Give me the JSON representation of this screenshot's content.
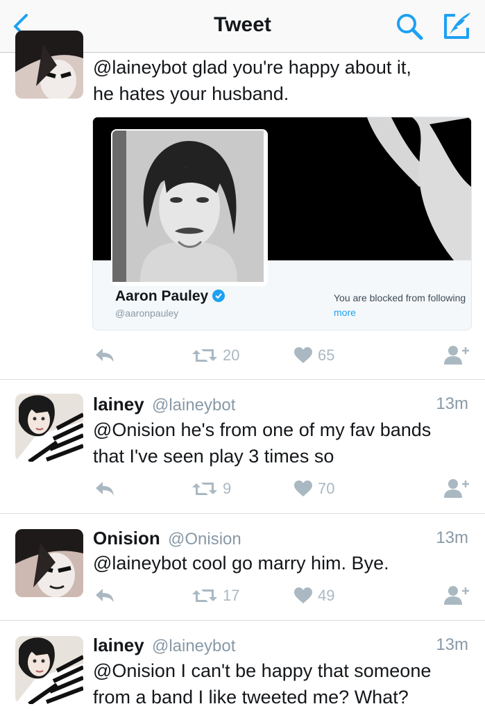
{
  "header": {
    "title": "Tweet",
    "back_icon": "chevron-left-icon",
    "search_icon": "search-icon",
    "compose_icon": "compose-icon",
    "accent_color": "#1da1f2"
  },
  "tweets": [
    {
      "text_lines": [
        "@laineybot glad you're happy about it,",
        "he hates your husband."
      ],
      "card": {
        "name": "Aaron Pauley",
        "handle": "@aaronpauley",
        "blocked_text": "You are blocked from following",
        "more_link": "more"
      },
      "retweets": "20",
      "likes": "65"
    },
    {
      "name": "lainey",
      "handle": "@laineybot",
      "time": "13m",
      "text_lines": [
        "@Onision he's from one of my fav bands",
        "that I've seen play 3 times so"
      ],
      "retweets": "9",
      "likes": "70"
    },
    {
      "name": "Onision",
      "handle": "@Onision",
      "time": "13m",
      "text_lines": [
        "@laineybot cool go marry him. Bye."
      ],
      "retweets": "17",
      "likes": "49"
    },
    {
      "name": "lainey",
      "handle": "@laineybot",
      "time": "13m",
      "text_lines": [
        "@Onision I can't be happy that someone",
        "from a band I like tweeted me? What?"
      ]
    }
  ]
}
